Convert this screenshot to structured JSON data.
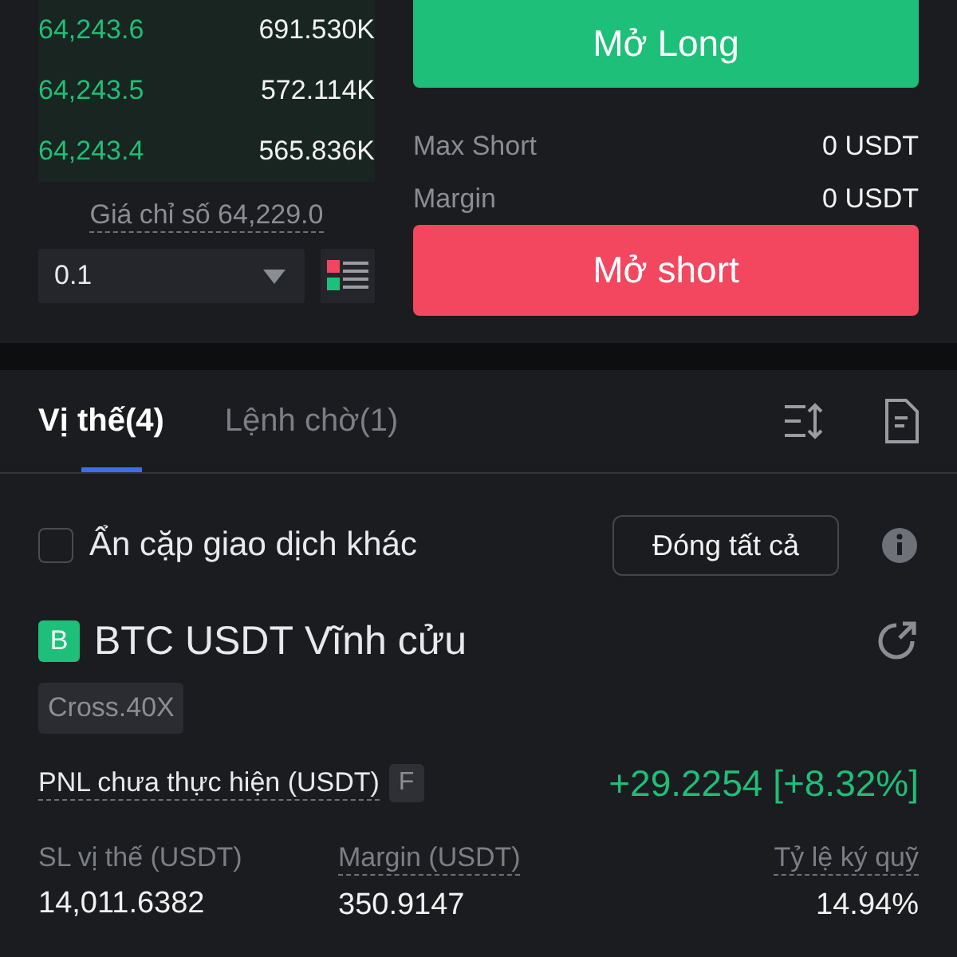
{
  "order_book": {
    "rows": [
      {
        "price": "64,243.6",
        "amount": "691.530K"
      },
      {
        "price": "64,243.5",
        "amount": "572.114K"
      },
      {
        "price": "64,243.4",
        "amount": "565.836K"
      }
    ],
    "index_price": "Giá chỉ số 64,229.0",
    "precision": "0.1"
  },
  "trade": {
    "long_button": "Mở Long",
    "stats": [
      {
        "label": "Max Short",
        "value": "0 USDT"
      },
      {
        "label": "Margin",
        "value": "0 USDT"
      }
    ],
    "short_button": "Mở short"
  },
  "tabs": [
    {
      "label": "Vị thế(4)",
      "selected": true
    },
    {
      "label": "Lệnh chờ(1)",
      "selected": false
    }
  ],
  "filter": {
    "label": "Ẩn cặp giao dịch khác",
    "checked": false
  },
  "close_all_button": "Đóng tất cả",
  "position": {
    "badge": "B",
    "symbol": "BTC USDT",
    "type": "Vĩnh cửu",
    "mode": "Cross.40X",
    "pnl_label": "PNL chưa thực hiện (USDT)",
    "pnl_flag": "F",
    "pnl_value": "+29.2254 [+8.32%]",
    "metrics": [
      {
        "label": "SL vị thế (USDT)",
        "value": "14,011.6382",
        "underlined": false
      },
      {
        "label": "Margin (USDT)",
        "value": "350.9147",
        "underlined": true
      },
      {
        "label": "Tỷ lệ ký quỹ",
        "value": "14.94%",
        "underlined": true
      }
    ]
  }
}
